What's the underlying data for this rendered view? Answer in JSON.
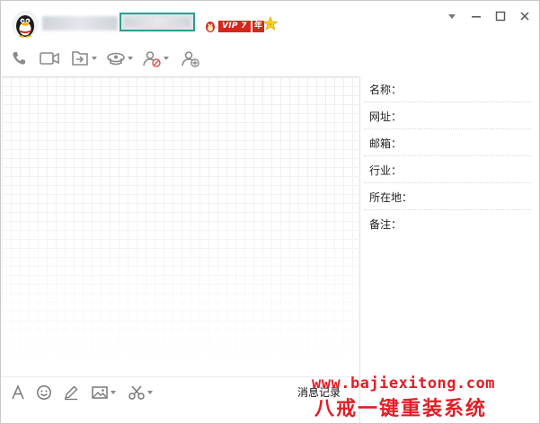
{
  "titlebar": {
    "vip_label": "VIP 7",
    "year_label": "年"
  },
  "icons": {
    "penguin": "penguin-icon",
    "star": "star-icon",
    "phone": "phone-icon",
    "video": "video-icon",
    "share_screen": "share-screen-icon",
    "group_app": "group-app-icon",
    "block_user": "block-user-icon",
    "add_friend": "add-friend-icon",
    "font": "font-icon",
    "emoji": "emoji-icon",
    "pen": "pen-icon",
    "image": "image-icon",
    "scissors": "scissors-icon"
  },
  "info_panel": {
    "fields": [
      {
        "label": "名称："
      },
      {
        "label": "网址："
      },
      {
        "label": "邮箱："
      },
      {
        "label": "行业："
      },
      {
        "label": "所在地："
      },
      {
        "label": "备注："
      }
    ]
  },
  "input_toolbar": {
    "history_label": "消息记录"
  },
  "watermark": {
    "url": "www.bajiexitong.com",
    "name": "八戒一键重装系统"
  },
  "colors": {
    "accent": "#2a9d8f",
    "vip_red": "#d9241c",
    "watermark_red": "#e01e26",
    "icon_gray": "#8a8a8a"
  }
}
